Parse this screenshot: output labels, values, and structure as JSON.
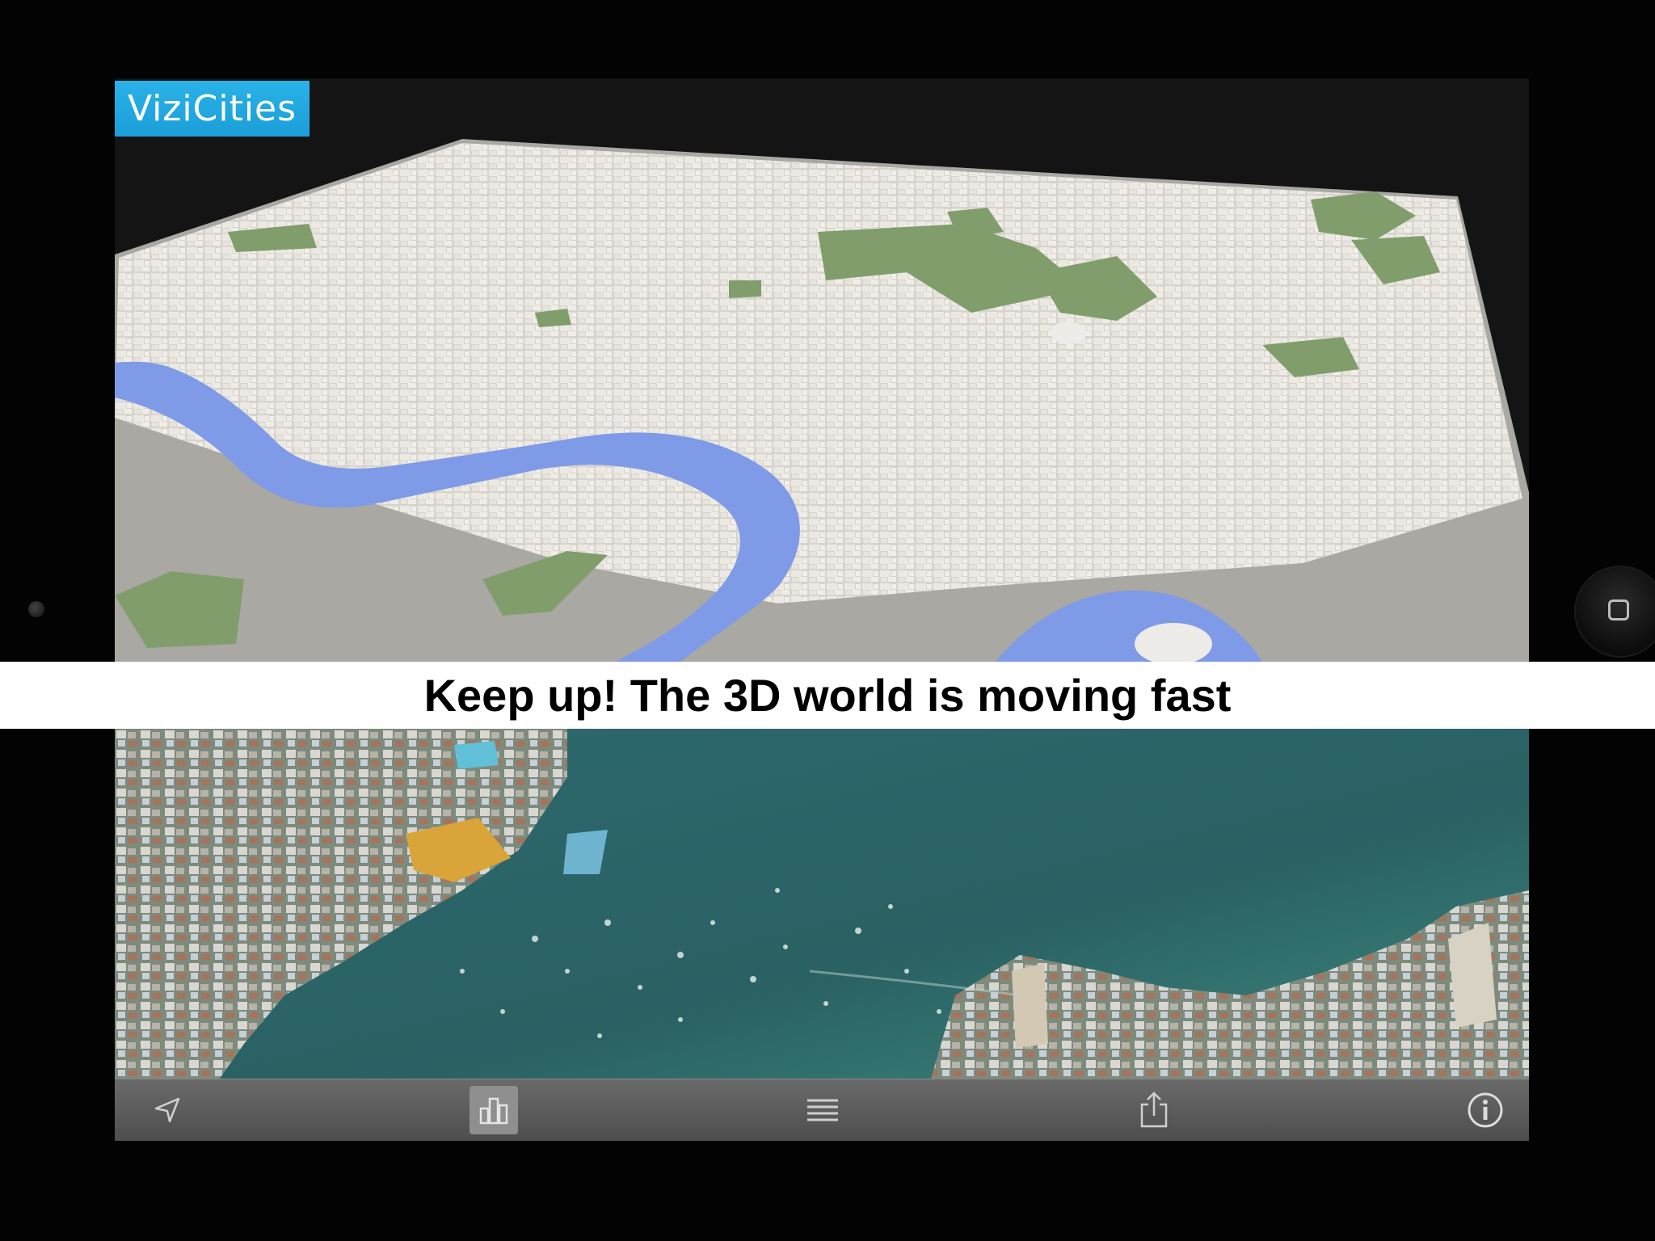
{
  "app": {
    "logo_text": "ViziCities",
    "caption": "Keep up! The 3D world is moving fast"
  },
  "toolbar": {
    "items": [
      {
        "icon": "location-arrow-icon",
        "active": false
      },
      {
        "icon": "3d-buildings-icon",
        "active": true
      },
      {
        "icon": "list-icon",
        "active": false
      },
      {
        "icon": "share-icon",
        "active": false
      },
      {
        "icon": "info-icon",
        "active": false
      }
    ]
  },
  "colors": {
    "logo_bg": "#1ea4dc",
    "ground": "#a9a8a3",
    "buildings": "#e6e3dd",
    "river": "#7f9ae6",
    "parks": "#7f9a68",
    "water_bay": "#2f6c6a",
    "toolbar": "#5a5a5a"
  }
}
